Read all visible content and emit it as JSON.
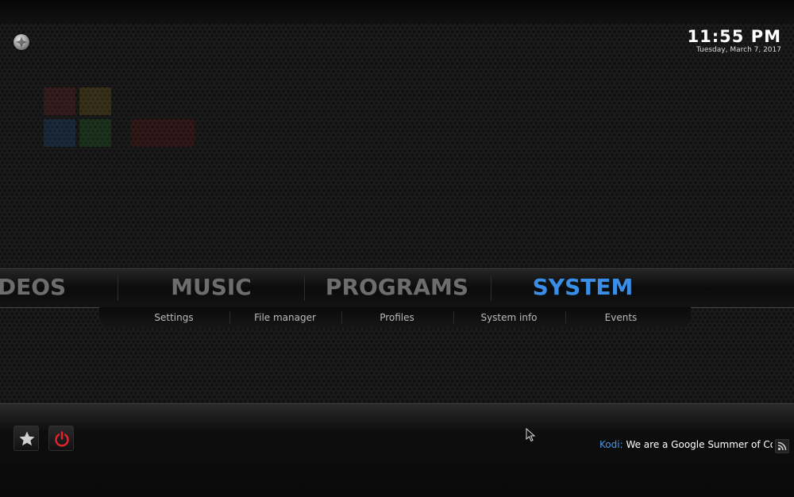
{
  "clock": {
    "time": "11:55 PM",
    "date": "Tuesday, March 7, 2017"
  },
  "main_menu": {
    "items": [
      {
        "label": "DEOS"
      },
      {
        "label": "MUSIC"
      },
      {
        "label": "PROGRAMS"
      },
      {
        "label": "SYSTEM"
      }
    ],
    "active": "SYSTEM"
  },
  "sub_menu": {
    "items": [
      {
        "label": "Settings"
      },
      {
        "label": "File manager"
      },
      {
        "label": "Profiles"
      },
      {
        "label": "System info"
      },
      {
        "label": "Events"
      }
    ]
  },
  "ticker": {
    "source": "Kodi:",
    "text": "We are a Google Summer of Co"
  },
  "icons": {
    "logo": "kodi-logo-icon",
    "favourites": "star-icon",
    "power": "power-icon",
    "rss": "rss-icon",
    "pointer": "mouse-pointer-icon"
  },
  "colors": {
    "accent": "#3a8ee8",
    "inactive": "#6d6d6d",
    "power": "#e8232a",
    "background": "#1c1c1c"
  }
}
